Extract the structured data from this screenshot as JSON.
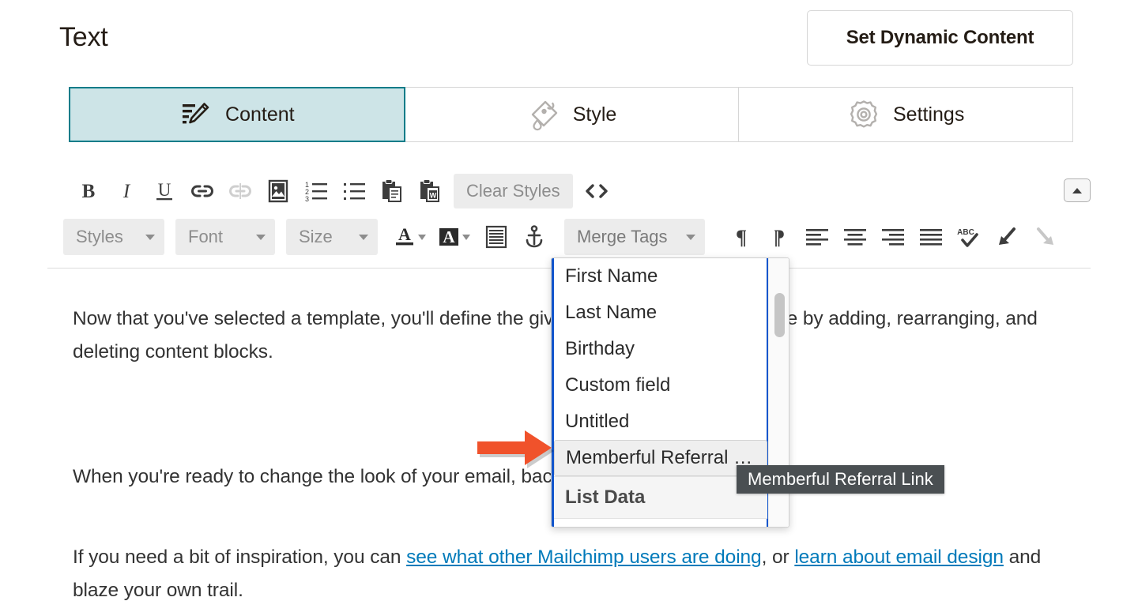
{
  "header": {
    "title": "Text",
    "dynamic_content_button": "Set Dynamic Content"
  },
  "tabs": [
    {
      "label": "Content",
      "icon": "edit-pencil-icon",
      "active": true
    },
    {
      "label": "Style",
      "icon": "paint-roller-icon",
      "active": false
    },
    {
      "label": "Settings",
      "icon": "gear-icon",
      "active": false
    }
  ],
  "toolbar": {
    "row1": [
      {
        "name": "bold-button",
        "glyph": "B",
        "disabled": false
      },
      {
        "name": "italic-button",
        "glyph": "I",
        "disabled": false
      },
      {
        "name": "underline-button",
        "glyph": "U",
        "disabled": false
      },
      {
        "name": "insert-link-button",
        "glyph": "link-icon",
        "disabled": false
      },
      {
        "name": "unlink-button",
        "glyph": "unlink-icon",
        "disabled": true
      },
      {
        "name": "insert-image-button",
        "glyph": "image-icon",
        "disabled": false
      },
      {
        "name": "ordered-list-button",
        "glyph": "numbered-list-icon",
        "disabled": false
      },
      {
        "name": "unordered-list-button",
        "glyph": "bullet-list-icon",
        "disabled": false
      },
      {
        "name": "paste-plain-button",
        "glyph": "paste-icon",
        "disabled": false
      },
      {
        "name": "paste-from-word-button",
        "glyph": "paste-word-icon",
        "disabled": false
      }
    ],
    "clear_styles_label": "Clear Styles",
    "code_view_name": "source-code-button",
    "collapse_toolbar_name": "collapse-toolbar-button",
    "selects": [
      {
        "name": "styles-select",
        "label": "Styles"
      },
      {
        "name": "font-select",
        "label": "Font"
      },
      {
        "name": "size-select",
        "label": "Size"
      }
    ],
    "merge_tags_label": "Merge Tags",
    "row2_icons": [
      {
        "name": "text-color-button",
        "glyph": "text-color-icon"
      },
      {
        "name": "background-color-button",
        "glyph": "highlight-color-icon"
      },
      {
        "name": "block-quote-button",
        "glyph": "lines-block-icon"
      },
      {
        "name": "anchor-button",
        "glyph": "anchor-icon"
      },
      {
        "name": "ltr-paragraph-button",
        "glyph": "pilcrow-icon"
      },
      {
        "name": "rtl-paragraph-button",
        "glyph": "pilcrow-rtl-icon"
      },
      {
        "name": "align-left-button",
        "glyph": "align-left-icon"
      },
      {
        "name": "align-center-button",
        "glyph": "align-center-icon"
      },
      {
        "name": "align-right-button",
        "glyph": "align-right-icon"
      },
      {
        "name": "align-justify-button",
        "glyph": "align-justify-icon"
      },
      {
        "name": "spellcheck-button",
        "glyph": "spellcheck-icon"
      },
      {
        "name": "undo-button",
        "glyph": "undo-arrow-icon"
      },
      {
        "name": "redo-button",
        "glyph": "redo-arrow-icon"
      }
    ]
  },
  "merge_tags_dropdown": {
    "items": [
      {
        "label": "First Name",
        "selected": false
      },
      {
        "label": "Last Name",
        "selected": false
      },
      {
        "label": "Birthday",
        "selected": false
      },
      {
        "label": "Custom field",
        "selected": false
      },
      {
        "label": "Untitled",
        "selected": false
      },
      {
        "label": "Memberful Referral …",
        "selected": true
      }
    ],
    "group_header": "List Data"
  },
  "tooltip": {
    "text": "Memberful Referral Link"
  },
  "body": {
    "paragraph1_a": "Now that you've selected a template, you'll define the ",
    "paragraph1_b": "give your content a place to live by adding, rearranging, and deleting content blocks.",
    "paragraph2_a": "When you're ready to change the look of your email,",
    "paragraph2_b": "background colors, borders, and other styles.",
    "paragraph3_pre": "If you need a bit of inspiration, you can ",
    "paragraph3_link1": "see what other Mailchimp users are doing",
    "paragraph3_mid": ", or ",
    "paragraph3_link2": "learn about email design",
    "paragraph3_post": " and blaze your own trail."
  },
  "colors": {
    "accent_teal": "#007C89",
    "active_tab_fill": "#CDE4E7",
    "link_blue": "#007ABA",
    "focus_blue": "#1155CC",
    "annotation_orange": "#F0522B",
    "tooltip_bg": "#4A4F52"
  }
}
